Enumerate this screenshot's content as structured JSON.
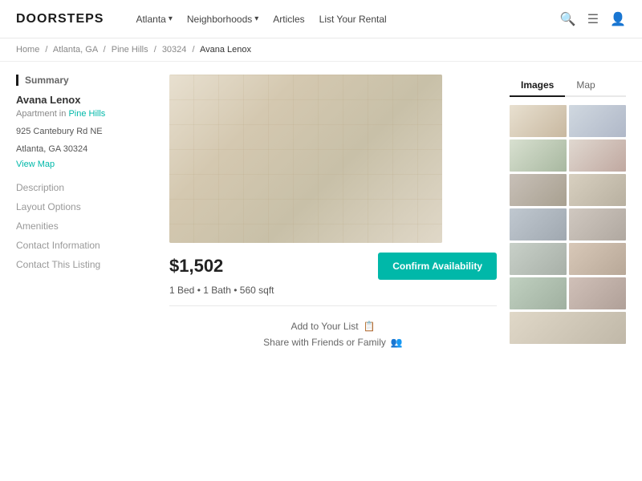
{
  "brand": {
    "logo": "DOORSTEPS"
  },
  "navbar": {
    "links": [
      {
        "label": "Atlanta",
        "hasDropdown": true
      },
      {
        "label": "Neighborhoods",
        "hasDropdown": true
      },
      {
        "label": "Articles",
        "hasDropdown": false
      },
      {
        "label": "List Your Rental",
        "hasDropdown": false
      }
    ],
    "search_placeholder": "Search"
  },
  "breadcrumb": {
    "items": [
      {
        "label": "Home",
        "href": "#"
      },
      {
        "label": "Atlanta, GA",
        "href": "#"
      },
      {
        "label": "Pine Hills",
        "href": "#"
      },
      {
        "label": "30324",
        "href": "#"
      },
      {
        "label": "Avana Lenox",
        "current": true
      }
    ]
  },
  "sidebar": {
    "section_title": "Summary",
    "property_name": "Avana Lenox",
    "property_type": "Apartment in",
    "property_type_link": "Pine Hills",
    "address_line1": "925 Cantebury Rd NE",
    "address_line2": "Atlanta, GA 30324",
    "view_map": "View Map",
    "nav_items": [
      "Description",
      "Layout Options",
      "Amenities",
      "Contact Information",
      "Contact This Listing"
    ]
  },
  "main": {
    "price": "$1,502",
    "details": "1 Bed • 1 Bath • 560 sqft",
    "confirm_button": "Confirm Availability",
    "action_add": "Add to Your List",
    "action_share": "Share with Friends or Family"
  },
  "gallery": {
    "tabs": [
      {
        "label": "Images",
        "active": true
      },
      {
        "label": "Map",
        "active": false
      }
    ],
    "thumbnail_count": 13
  }
}
